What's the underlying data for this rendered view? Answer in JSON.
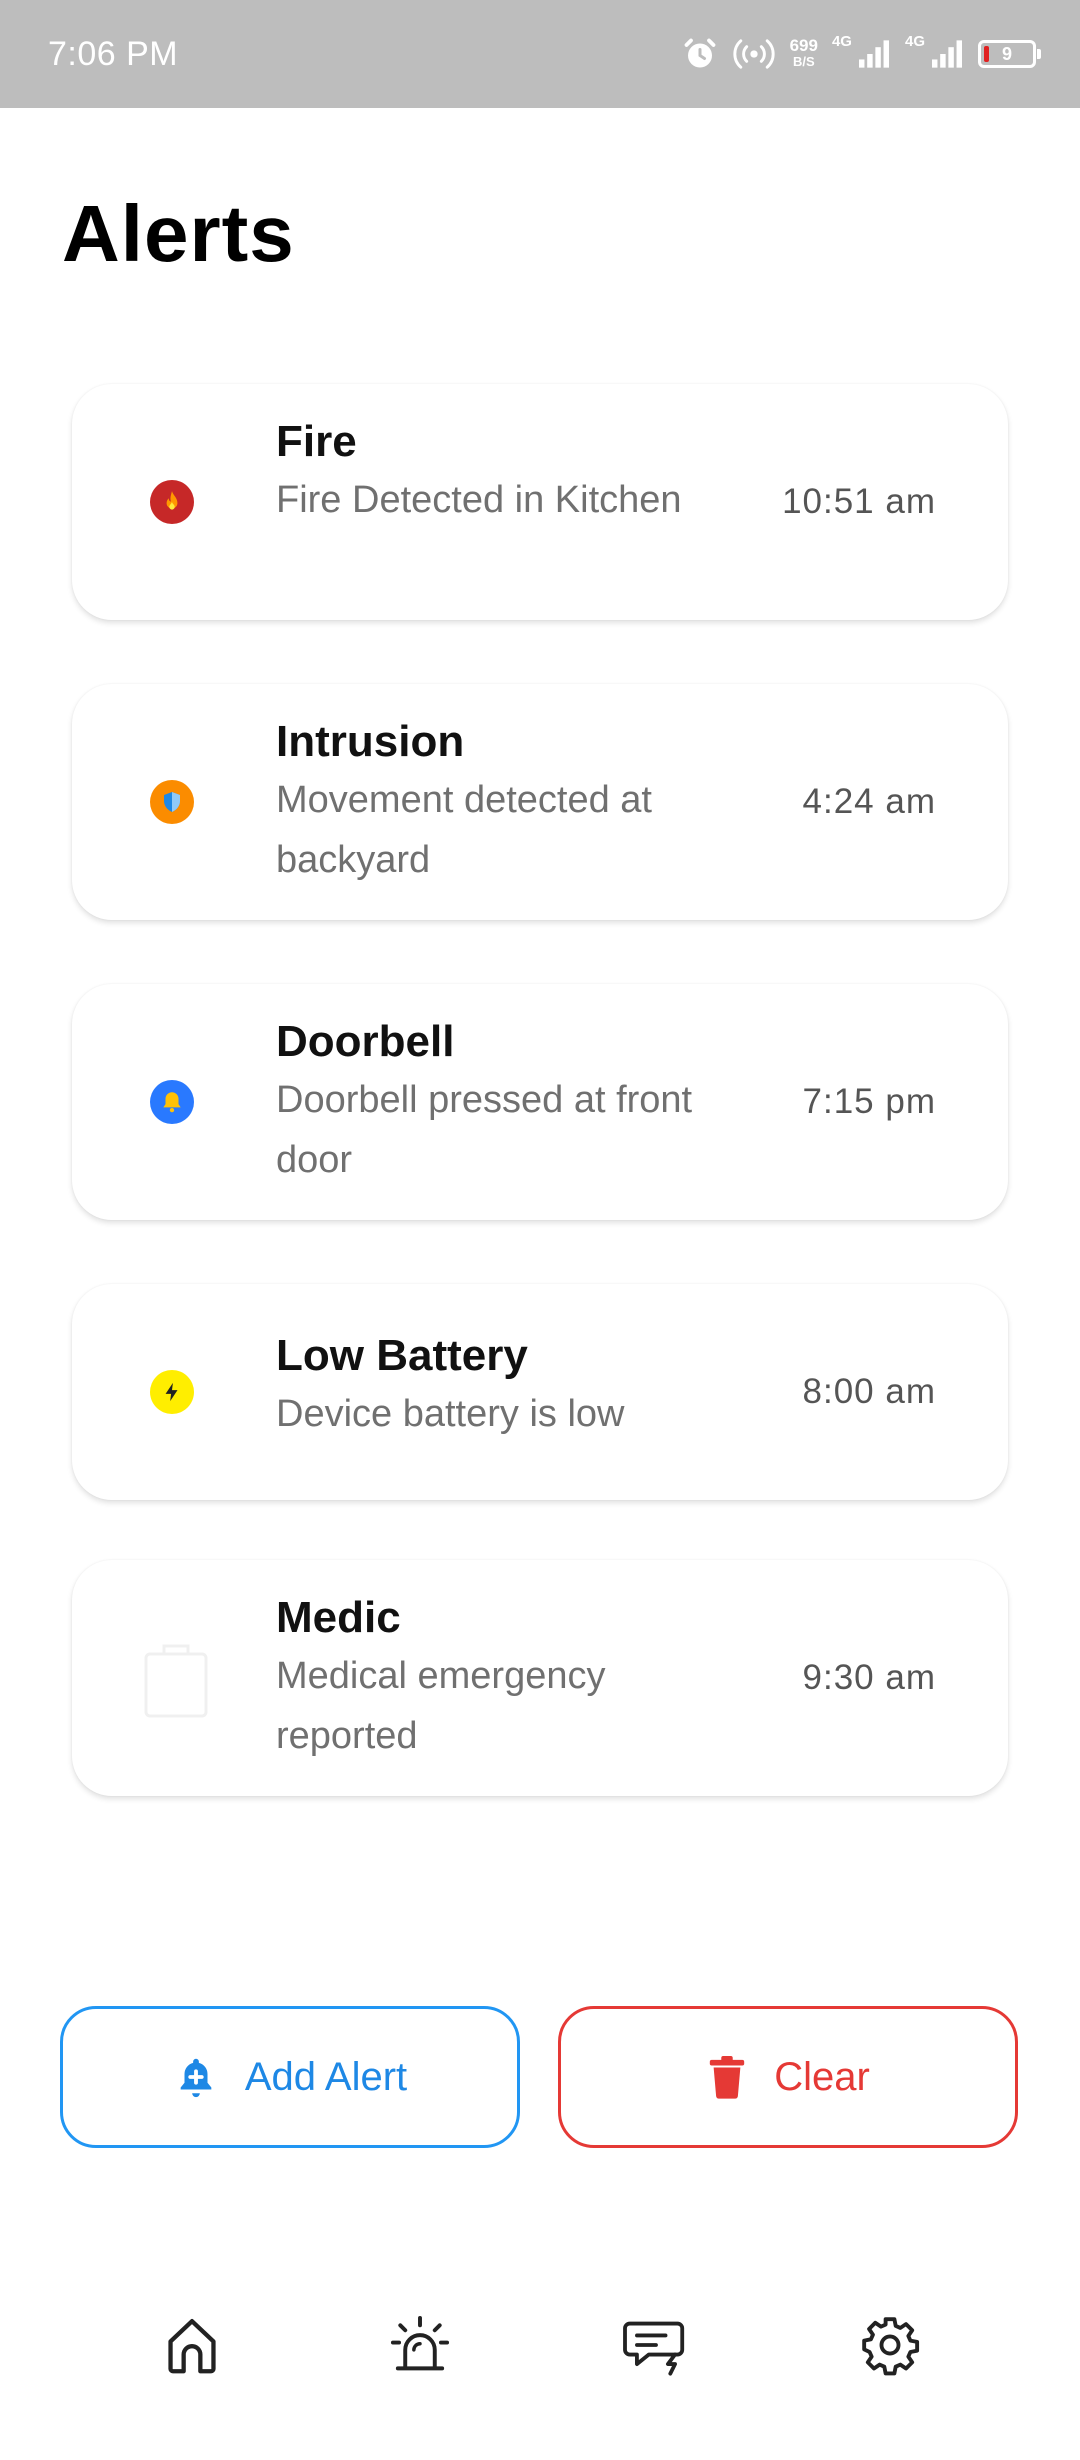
{
  "status_bar": {
    "time": "7:06 PM",
    "net_speed_value": "699",
    "net_speed_unit": "B/S",
    "sim1_label": "4G",
    "sim2_label": "4G",
    "battery_level": "9"
  },
  "page": {
    "title": "Alerts"
  },
  "alerts": [
    {
      "title": "Fire",
      "description": "Fire Detected in Kitchen",
      "time": "10:51 am",
      "icon": "fire-icon",
      "color": "#c62828"
    },
    {
      "title": "Intrusion",
      "description": "Movement detected at backyard",
      "time": "4:24 am",
      "icon": "shield-icon",
      "color": "#fb8c00"
    },
    {
      "title": "Doorbell",
      "description": "Doorbell pressed at front door",
      "time": "7:15 pm",
      "icon": "bell-icon",
      "color": "#2979ff"
    },
    {
      "title": "Low Battery",
      "description": "Device battery is low",
      "time": "8:00 am",
      "icon": "bolt-icon",
      "color": "#ffee00"
    },
    {
      "title": "Medic",
      "description": "Medical emergency reported",
      "time": "9:30 am",
      "icon": "medical-bag-icon",
      "color": "#f2f2f2"
    }
  ],
  "actions": {
    "add_label": "Add Alert",
    "clear_label": "Clear",
    "add_color": "#2196f3",
    "clear_color": "#e53935"
  },
  "bottom_nav": [
    {
      "icon": "home-icon"
    },
    {
      "icon": "siren-icon"
    },
    {
      "icon": "message-alert-icon"
    },
    {
      "icon": "gear-icon"
    }
  ]
}
